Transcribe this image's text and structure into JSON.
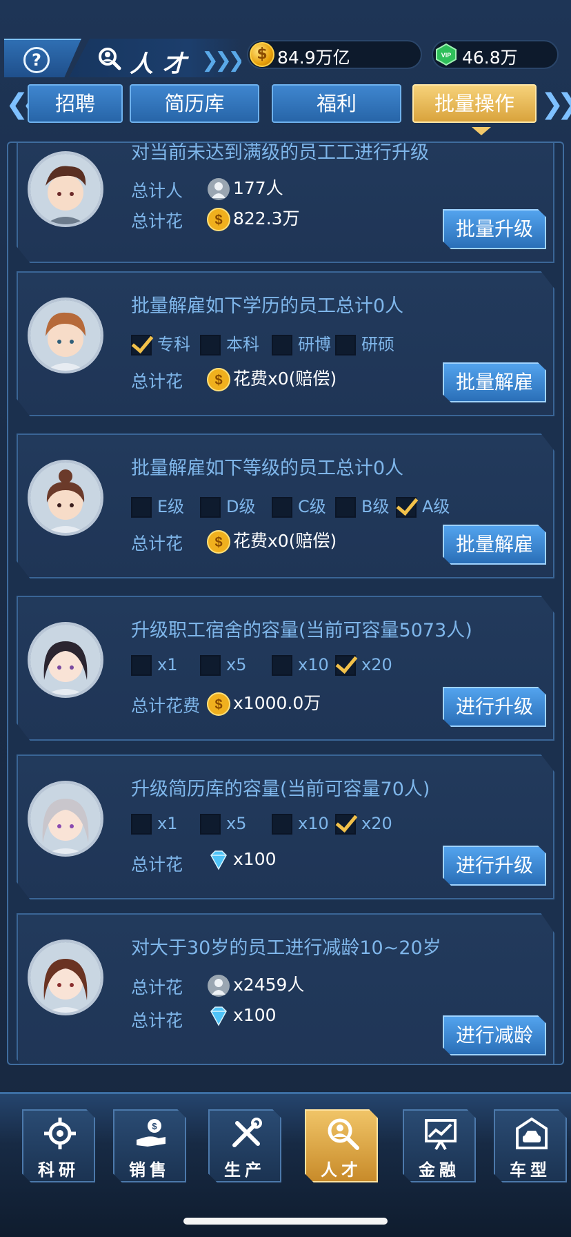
{
  "header": {
    "help_label": "?",
    "title": "人才",
    "gold_value": "84.9万亿",
    "gem_value": "46.8万",
    "gem_label": "VIP"
  },
  "tabs": [
    {
      "label": "招聘",
      "active": false
    },
    {
      "label": "简历库",
      "active": false
    },
    {
      "label": "福利",
      "active": false
    },
    {
      "label": "批量操作",
      "active": true
    }
  ],
  "cards": [
    {
      "title": "对当前未达到满级的员工工进行升级",
      "rows": [
        {
          "label": "总计人",
          "icon": "person-icon",
          "value": "177人"
        },
        {
          "label": "总计花",
          "icon": "coin-icon",
          "value": "822.3万"
        }
      ],
      "button": "批量升级"
    },
    {
      "title": "批量解雇如下学历的员工总计0人",
      "options": [
        {
          "label": "专科",
          "checked": true
        },
        {
          "label": "本科",
          "checked": false
        },
        {
          "label": "研博",
          "checked": false
        },
        {
          "label": "研硕",
          "checked": false
        }
      ],
      "rows": [
        {
          "label": "总计花",
          "icon": "coin-icon",
          "value": "花费x0(赔偿)"
        }
      ],
      "button": "批量解雇"
    },
    {
      "title": "批量解雇如下等级的员工总计0人",
      "options": [
        {
          "label": "E级",
          "checked": false
        },
        {
          "label": "D级",
          "checked": false
        },
        {
          "label": "C级",
          "checked": false
        },
        {
          "label": "B级",
          "checked": false
        },
        {
          "label": "A级",
          "checked": true
        }
      ],
      "rows": [
        {
          "label": "总计花",
          "icon": "coin-icon",
          "value": "花费x0(赔偿)"
        }
      ],
      "button": "批量解雇"
    },
    {
      "title": "升级职工宿舍的容量(当前可容量5073人)",
      "options": [
        {
          "label": "x1",
          "checked": false
        },
        {
          "label": "x5",
          "checked": false
        },
        {
          "label": "x10",
          "checked": false
        },
        {
          "label": "x20",
          "checked": true
        }
      ],
      "rows": [
        {
          "label": "总计花费",
          "icon": "coin-icon",
          "value": "x1000.0万"
        }
      ],
      "button": "进行升级"
    },
    {
      "title": "升级简历库的容量(当前可容量70人)",
      "options": [
        {
          "label": "x1",
          "checked": false
        },
        {
          "label": "x5",
          "checked": false
        },
        {
          "label": "x10",
          "checked": false
        },
        {
          "label": "x20",
          "checked": true
        }
      ],
      "rows": [
        {
          "label": "总计花",
          "icon": "diamond-icon",
          "value": "x100"
        }
      ],
      "button": "进行升级"
    },
    {
      "title": "对大于30岁的员工进行减龄10~20岁",
      "rows": [
        {
          "label": "总计花",
          "icon": "person-icon",
          "value": "x2459人"
        },
        {
          "label": "总计花",
          "icon": "diamond-icon",
          "value": "x100"
        }
      ],
      "button": "进行减龄"
    }
  ],
  "nav": [
    {
      "label": "科研",
      "icon": "research-gear-icon",
      "active": false
    },
    {
      "label": "销售",
      "icon": "sales-hand-coin-icon",
      "active": false
    },
    {
      "label": "生产",
      "icon": "tools-icon",
      "active": false
    },
    {
      "label": "人才",
      "icon": "talent-search-icon",
      "active": true
    },
    {
      "label": "金融",
      "icon": "finance-chart-icon",
      "active": false
    },
    {
      "label": "车型",
      "icon": "car-garage-icon",
      "active": false
    }
  ],
  "colors": {
    "accent_blue": "#2a6fb8",
    "active_gold": "#d9a33c",
    "check_gold": "#f2c14a",
    "text_blue": "#7fb6ea"
  }
}
